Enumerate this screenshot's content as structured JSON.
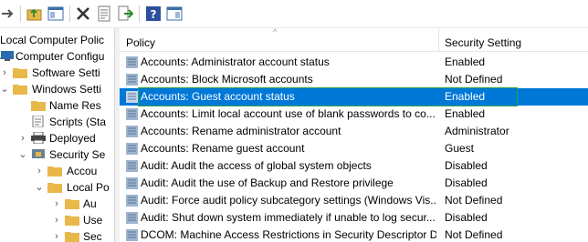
{
  "toolbar": {
    "buttons": [
      "back-icon",
      "up-folder-icon",
      "show-hide-tree-icon",
      "delete-icon",
      "properties-icon",
      "export-list-icon",
      "help-icon",
      "show-action-pane-icon"
    ]
  },
  "tree": {
    "items": [
      {
        "label": "Local Computer Polic",
        "name": "tree-item-local-computer-policy"
      },
      {
        "label": "Computer Configu",
        "name": "tree-item-computer-configuration"
      },
      {
        "label": "Software Setti",
        "name": "tree-item-software-settings"
      },
      {
        "label": "Windows Setti",
        "name": "tree-item-windows-settings"
      },
      {
        "label": "Name Res",
        "name": "tree-item-name-resolution"
      },
      {
        "label": "Scripts (Sta",
        "name": "tree-item-scripts"
      },
      {
        "label": "Deployed",
        "name": "tree-item-deployed-printers"
      },
      {
        "label": "Security Se",
        "name": "tree-item-security-settings"
      },
      {
        "label": "Accou",
        "name": "tree-item-account-policies"
      },
      {
        "label": "Local Po",
        "name": "tree-item-local-policies"
      },
      {
        "label": "Au",
        "name": "tree-item-audit-policy"
      },
      {
        "label": "Use",
        "name": "tree-item-user-rights"
      },
      {
        "label": "Sec",
        "name": "tree-item-security-options"
      }
    ]
  },
  "list": {
    "header": {
      "policy": "Policy",
      "setting": "Security Setting"
    },
    "rows": [
      {
        "policy": "Accounts: Administrator account status",
        "setting": "Enabled"
      },
      {
        "policy": "Accounts: Block Microsoft accounts",
        "setting": "Not Defined"
      },
      {
        "policy": "Accounts: Guest account status",
        "setting": "Enabled"
      },
      {
        "policy": "Accounts: Limit local account use of blank passwords to co...",
        "setting": "Enabled"
      },
      {
        "policy": "Accounts: Rename administrator account",
        "setting": "Administrator"
      },
      {
        "policy": "Accounts: Rename guest account",
        "setting": "Guest"
      },
      {
        "policy": "Audit: Audit the access of global system objects",
        "setting": "Disabled"
      },
      {
        "policy": "Audit: Audit the use of Backup and Restore privilege",
        "setting": "Disabled"
      },
      {
        "policy": "Audit: Force audit policy subcategory settings (Windows Vis...",
        "setting": "Not Defined"
      },
      {
        "policy": "Audit: Shut down system immediately if unable to log secur...",
        "setting": "Disabled"
      },
      {
        "policy": "DCOM: Machine Access Restrictions in Security Descriptor D...",
        "setting": "Not Defined"
      }
    ]
  },
  "colors": {
    "selection": "#0078d7",
    "focus": "#2aa546",
    "folder": "#e8b84a"
  }
}
